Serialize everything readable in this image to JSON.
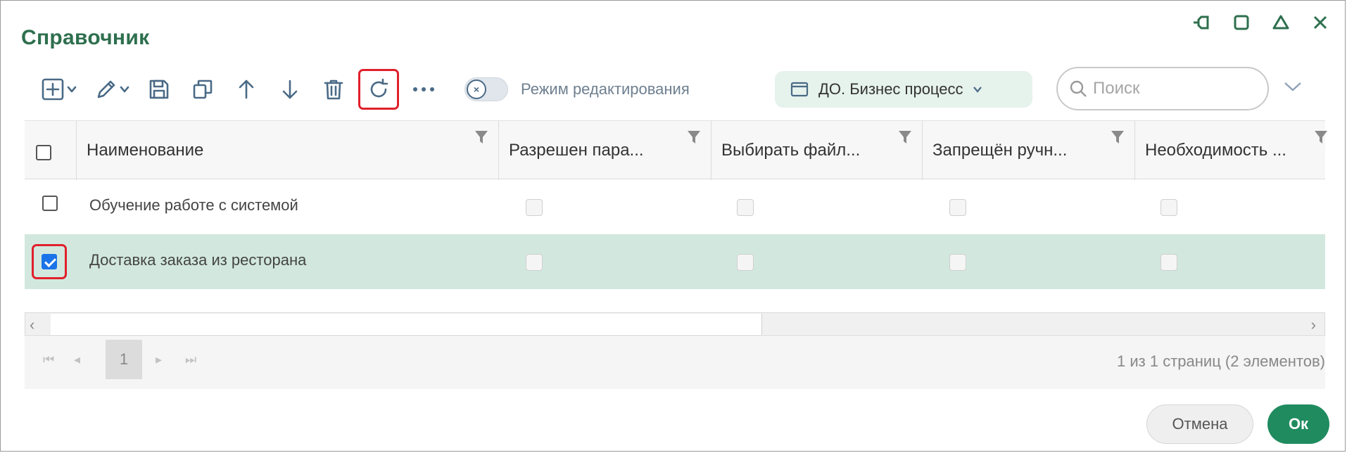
{
  "dialog": {
    "title": "Справочник"
  },
  "toolbar": {
    "edit_mode_label": "Режим редактирования",
    "process_select": "ДО. Бизнес процесс",
    "search_placeholder": "Поиск"
  },
  "grid": {
    "columns": [
      {
        "label": "Наименование"
      },
      {
        "label": "Разрешен пара..."
      },
      {
        "label": "Выбирать файл..."
      },
      {
        "label": "Запрещён ручн..."
      },
      {
        "label": "Необходимость ..."
      }
    ],
    "rows": [
      {
        "name": "Обучение работе с системой",
        "checked": false
      },
      {
        "name": "Доставка заказа из ресторана",
        "checked": true
      }
    ]
  },
  "pager": {
    "current_page": "1",
    "info": "1 из 1 страниц (2 элементов)"
  },
  "footer": {
    "cancel_label": "Отмена",
    "ok_label": "Ок"
  },
  "colors": {
    "accent": "#2e6f4e",
    "ok": "#1f8b5f",
    "selected_row": "#d2e8df",
    "highlight": "#e0202b",
    "checkbox": "#1a73e8"
  }
}
